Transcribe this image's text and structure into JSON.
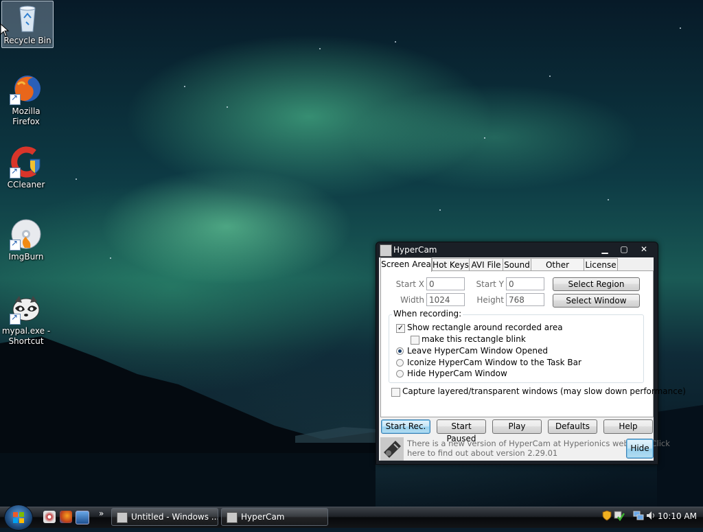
{
  "desktop": {
    "icons": [
      {
        "name": "recycle-bin",
        "label": "Recycle Bin"
      },
      {
        "name": "firefox",
        "label": "Mozilla Firefox",
        "line1": "Mozilla",
        "line2": "Firefox"
      },
      {
        "name": "ccleaner",
        "label": "CCleaner"
      },
      {
        "name": "imgburn",
        "label": "ImgBurn"
      },
      {
        "name": "mypal",
        "line1": "mypal.exe -",
        "line2": "Shortcut"
      }
    ]
  },
  "window": {
    "title": "HyperCam",
    "tabs": [
      "Screen Area",
      "Hot Keys",
      "AVI File",
      "Sound",
      "Other Options",
      "License"
    ],
    "active_tab": "Screen Area",
    "fields": {
      "start_x_label": "Start X",
      "start_x": "0",
      "start_y_label": "Start Y",
      "start_y": "0",
      "width_label": "Width",
      "width": "1024",
      "height_label": "Height",
      "height": "768"
    },
    "select_region": "Select Region",
    "select_window": "Select Window",
    "group_title": "When recording:",
    "options": {
      "show_rect": "Show rectangle around recorded area",
      "blink": "make this rectangle blink",
      "leave_open": "Leave HyperCam Window Opened",
      "iconize": "Iconize HyperCam Window to the Task Bar",
      "hide": "Hide HyperCam Window"
    },
    "capture_layered": "Capture layered/transparent windows (may slow down performance)",
    "buttons": {
      "start_rec": "Start Rec.",
      "start_paused": "Start Paused",
      "play": "Play",
      "defaults": "Defaults",
      "help": "Help",
      "hide": "Hide"
    },
    "notice_line1": "There is a new version of HyperCam at Hyperionics web site! Click",
    "notice_line2": "here to find out about version 2.29.01",
    "state": {
      "show_rect": true,
      "blink": false,
      "recording_mode": "leave_open",
      "capture_layered": false
    }
  },
  "taskbar": {
    "tasks": [
      {
        "label": "Untitled - Windows ...",
        "icon": "windows-media-icon"
      },
      {
        "label": "HyperCam",
        "icon": "hypercam-icon"
      }
    ],
    "chevron": "»",
    "clock": "10:10 AM"
  }
}
